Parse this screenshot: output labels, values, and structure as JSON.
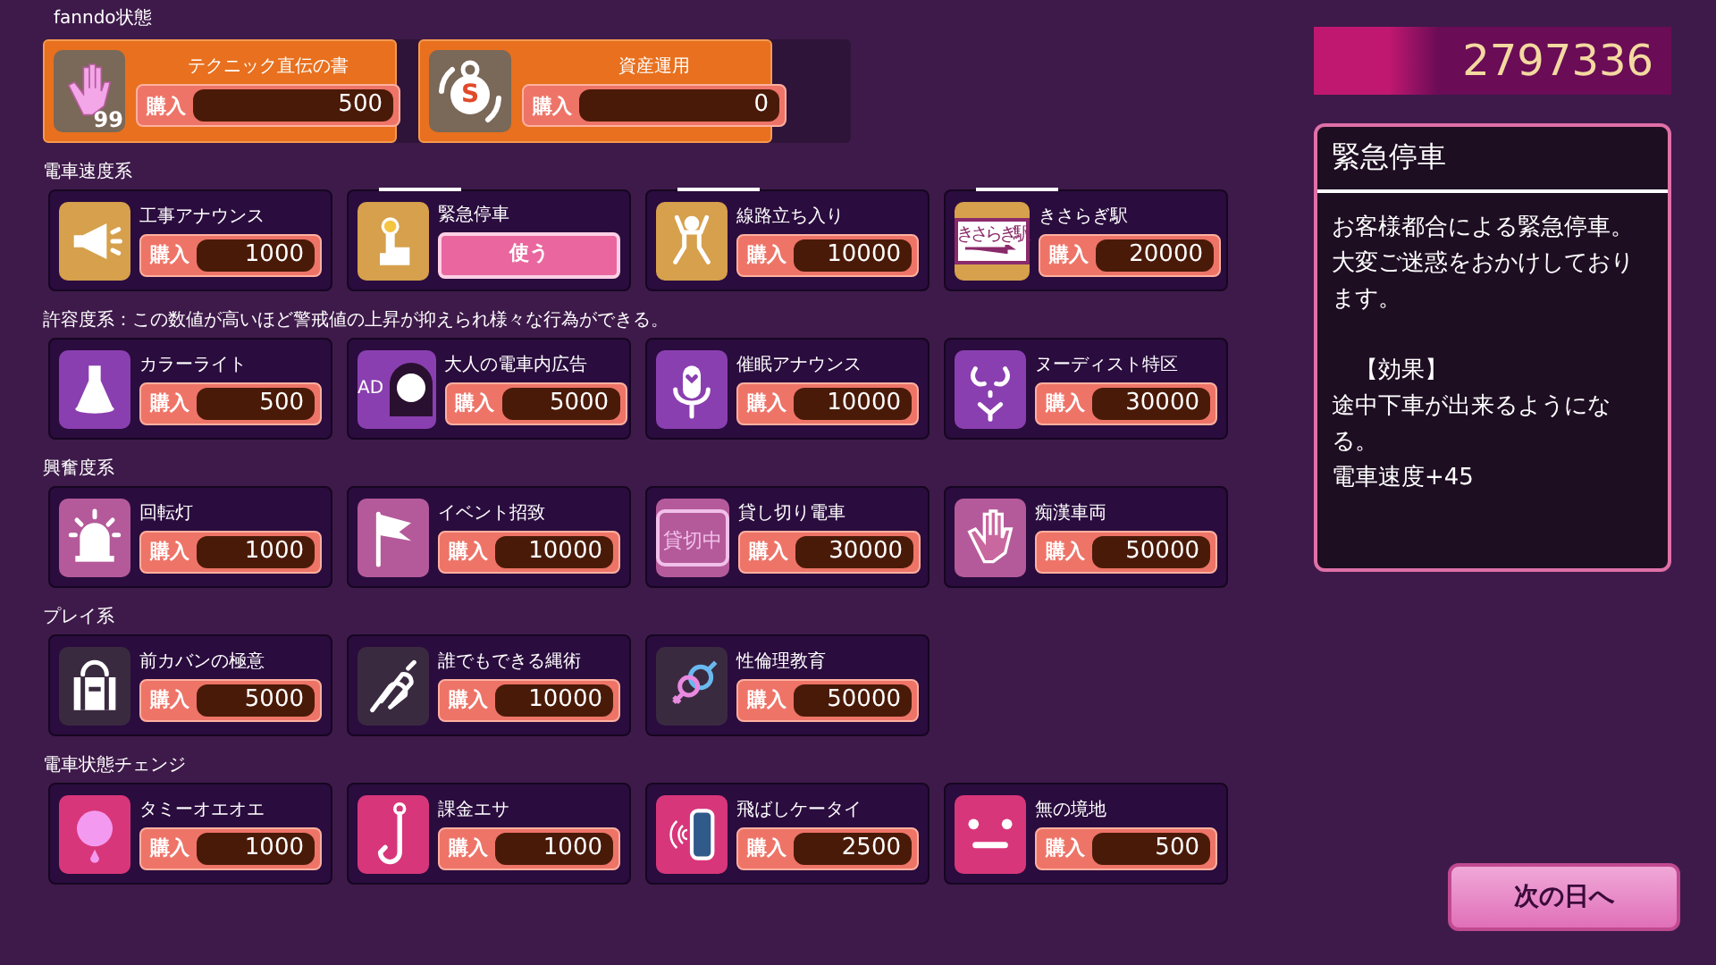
{
  "top_section": {
    "title": "fanndo状態",
    "items": [
      {
        "name": "テクニック直伝の書",
        "buy_label": "購入",
        "price": "500",
        "badge": "99"
      },
      {
        "name": "資産運用",
        "buy_label": "購入",
        "price": "0",
        "icon_text": "S"
      }
    ]
  },
  "sections": [
    {
      "title": "電車速度系",
      "kind": "speed",
      "items": [
        {
          "name": "工事アナウンス",
          "kind": "buy",
          "buy_label": "購入",
          "price": "1000",
          "marked": false
        },
        {
          "name": "緊急停車",
          "kind": "use",
          "use_label": "使う",
          "marked": true
        },
        {
          "name": "線路立ち入り",
          "kind": "buy",
          "buy_label": "購入",
          "price": "10000",
          "marked": true
        },
        {
          "name": "きさらぎ駅",
          "kind": "buy",
          "buy_label": "購入",
          "price": "20000",
          "marked": true,
          "icon_text": "きさらぎ駅"
        }
      ]
    },
    {
      "title": "許容度系：この数値が高いほど警戒値の上昇が抑えられ様々な行為ができる。",
      "kind": "tolerance",
      "items": [
        {
          "name": "カラーライト",
          "kind": "buy",
          "buy_label": "購入",
          "price": "500",
          "marked": false
        },
        {
          "name": "大人の電車内広告",
          "kind": "buy",
          "buy_label": "購入",
          "price": "5000",
          "marked": false,
          "icon_text": "AD"
        },
        {
          "name": "催眠アナウンス",
          "kind": "buy",
          "buy_label": "購入",
          "price": "10000",
          "marked": false
        },
        {
          "name": "ヌーディスト特区",
          "kind": "buy",
          "buy_label": "購入",
          "price": "30000",
          "marked": false
        }
      ]
    },
    {
      "title": "興奮度系",
      "kind": "excitement",
      "items": [
        {
          "name": "回転灯",
          "kind": "buy",
          "buy_label": "購入",
          "price": "1000",
          "marked": false
        },
        {
          "name": "イベント招致",
          "kind": "buy",
          "buy_label": "購入",
          "price": "10000",
          "marked": false
        },
        {
          "name": "貸し切り電車",
          "kind": "buy",
          "buy_label": "購入",
          "price": "30000",
          "marked": false,
          "icon_text": "貸切中"
        },
        {
          "name": "痴漢車両",
          "kind": "buy",
          "buy_label": "購入",
          "price": "50000",
          "marked": false
        }
      ]
    },
    {
      "title": "プレイ系",
      "kind": "play",
      "items": [
        {
          "name": "前カバンの極意",
          "kind": "buy",
          "buy_label": "購入",
          "price": "5000",
          "marked": false
        },
        {
          "name": "誰でもできる縄術",
          "kind": "buy",
          "buy_label": "購入",
          "price": "10000",
          "marked": false
        },
        {
          "name": "性倫理教育",
          "kind": "buy",
          "buy_label": "購入",
          "price": "50000",
          "marked": false
        }
      ]
    },
    {
      "title": "電車状態チェンジ",
      "kind": "change",
      "items": [
        {
          "name": "タミーオエオエ",
          "kind": "buy",
          "buy_label": "購入",
          "price": "1000",
          "marked": false
        },
        {
          "name": "課金エサ",
          "kind": "buy",
          "buy_label": "購入",
          "price": "1000",
          "marked": false
        },
        {
          "name": "飛ばしケータイ",
          "kind": "buy",
          "buy_label": "購入",
          "price": "2500",
          "marked": false
        },
        {
          "name": "無の境地",
          "kind": "buy",
          "buy_label": "購入",
          "price": "500",
          "marked": false
        }
      ]
    }
  ],
  "money": "2797336",
  "detail": {
    "title": "緊急停車",
    "blocks": [
      [
        "お客様都合による緊急停車。大変ご迷惑をおかけしております。"
      ],
      [
        "　【効果】",
        "途中下車が出来るようになる。",
        "電車速度+45"
      ]
    ]
  },
  "next_button": "次の日へ"
}
